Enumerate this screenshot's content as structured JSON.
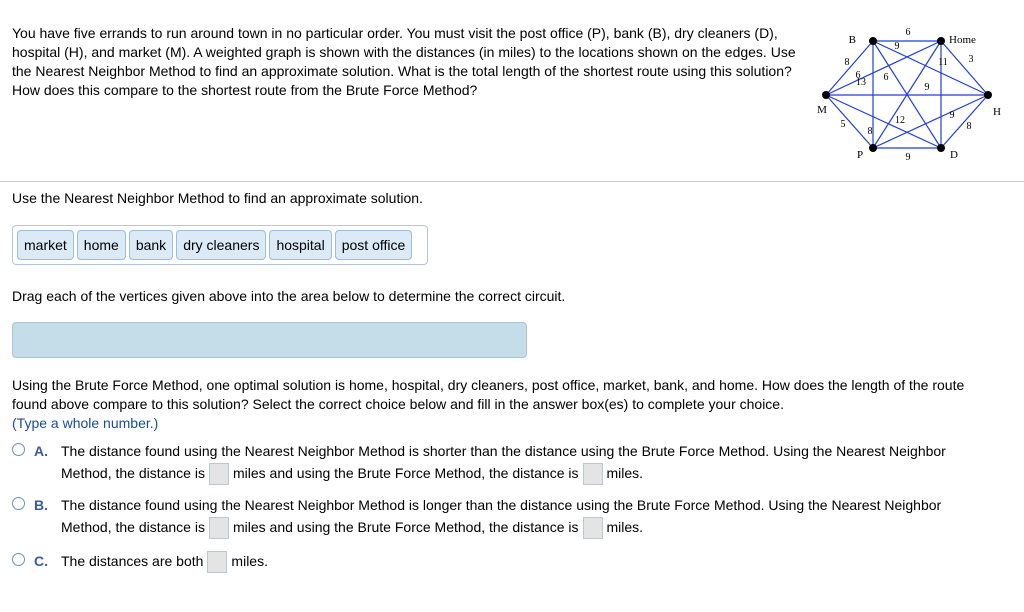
{
  "question": "You have five errands to run around town in no particular order. You must visit the post office (P), bank (B), dry cleaners (D), hospital (H), and market (M). A weighted graph is shown with the distances (in miles) to the locations shown on the edges. Use the Nearest Neighbor Method to find an approximate solution. What is the total length of the shortest route using this solution? How does this compare to the shortest route from the Brute Force Method?",
  "graph": {
    "vertices": {
      "B": "B",
      "Home": "Home",
      "M": "M",
      "H": "H",
      "P": "P",
      "D": "D"
    },
    "edges": [
      {
        "from": "B",
        "to": "Home",
        "weight": "6"
      },
      {
        "from": "B",
        "to": "H",
        "weight": "9"
      },
      {
        "from": "B",
        "to": "M",
        "weight": "8"
      },
      {
        "from": "B",
        "to": "D",
        "weight": "13"
      },
      {
        "from": "B",
        "to": "P",
        "weight": "8"
      },
      {
        "from": "Home",
        "to": "M",
        "weight": "6"
      },
      {
        "from": "Home",
        "to": "P",
        "weight": "6"
      },
      {
        "from": "Home",
        "to": "D",
        "weight": "11"
      },
      {
        "from": "Home",
        "to": "H",
        "weight": "3"
      },
      {
        "from": "M",
        "to": "H",
        "weight": "9"
      },
      {
        "from": "M",
        "to": "D",
        "weight": "12"
      },
      {
        "from": "M",
        "to": "P",
        "weight": "5"
      },
      {
        "from": "P",
        "to": "H",
        "weight": "9"
      },
      {
        "from": "P",
        "to": "D",
        "weight": "9"
      },
      {
        "from": "H",
        "to": "D",
        "weight": "8"
      }
    ],
    "edge_color": "#1f3fd6"
  },
  "instruction_nn": "Use the Nearest Neighbor Method to find an approximate solution.",
  "tiles": [
    "market",
    "home",
    "bank",
    "dry cleaners",
    "hospital",
    "post office"
  ],
  "instruction_drag": "Drag each of the vertices given above into the area below to determine the correct circuit.",
  "brute_force_text": "Using the Brute Force Method, one optimal solution is home, hospital, dry cleaners, post office, market, bank, and home. How does the length of the route found above compare to this solution? Select the correct choice below and fill in the answer box(es) to complete your choice.",
  "hint": "(Type a whole number.)",
  "choices": {
    "A": {
      "letter": "A.",
      "line1": "The distance found using the Nearest Neighbor Method is shorter than the distance using the Brute Force Method. Using the Nearest Neighbor",
      "pre": "Method, the distance is",
      "mid": "miles and using the Brute Force Method, the distance is",
      "post": "miles."
    },
    "B": {
      "letter": "B.",
      "line1": "The distance found using the Nearest Neighbor Method is longer than the distance using the Brute Force Method. Using the Nearest Neighbor",
      "pre": "Method, the distance is",
      "mid": "miles and using the Brute Force Method, the distance is",
      "post": "miles."
    },
    "C": {
      "letter": "C.",
      "pre": "The distances are both",
      "post": "miles."
    }
  }
}
